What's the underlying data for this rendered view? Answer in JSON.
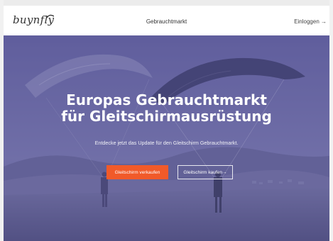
{
  "header": {
    "logo_text": "buynfly",
    "center_title": "Gebrauchtmarkt",
    "login_label": "Einloggen →"
  },
  "hero": {
    "headline_line1": "Europas Gebrauchtmarkt",
    "headline_line2": "für Gleitschirmausrüstung",
    "subheadline": "Entdecke jetzt das Update für den Gleitschirm Gebrauchtmarkt.",
    "primary_button": "Gleitschirm verkaufen",
    "secondary_button": "Gleitschirm kaufen→"
  },
  "colors": {
    "accent": "#f15a29",
    "hero_overlay": "#5b5b92",
    "header_bg": "#ffffff"
  }
}
